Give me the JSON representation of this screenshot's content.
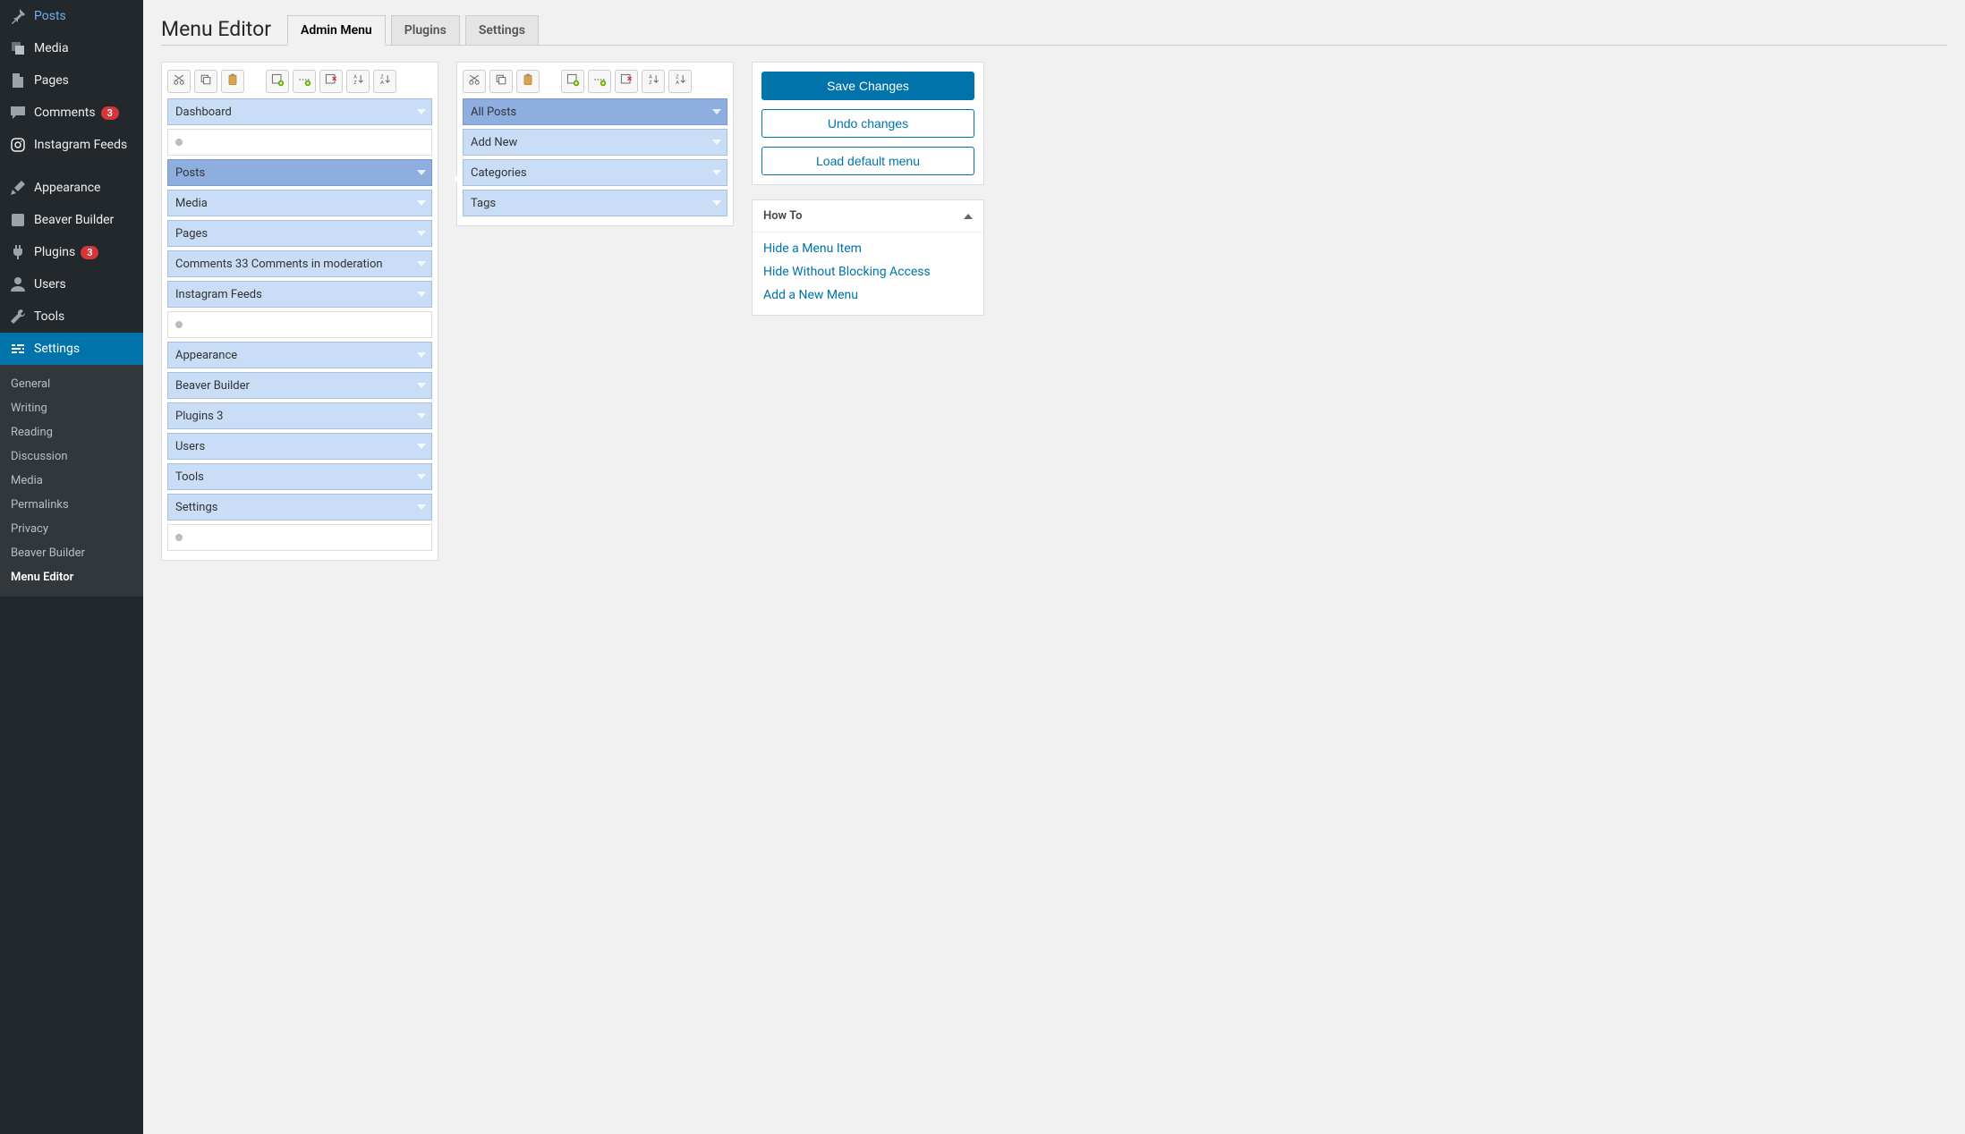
{
  "sidebar": {
    "items": [
      {
        "label": "Posts",
        "icon": "pin"
      },
      {
        "label": "Media",
        "icon": "media"
      },
      {
        "label": "Pages",
        "icon": "pages"
      },
      {
        "label": "Comments",
        "icon": "comments",
        "badge": "3"
      },
      {
        "label": "Instagram Feeds",
        "icon": "instagram"
      }
    ],
    "items2": [
      {
        "label": "Appearance",
        "icon": "brush"
      },
      {
        "label": "Beaver Builder",
        "icon": "generic"
      },
      {
        "label": "Plugins",
        "icon": "plug",
        "badge": "3"
      },
      {
        "label": "Users",
        "icon": "user"
      },
      {
        "label": "Tools",
        "icon": "wrench"
      },
      {
        "label": "Settings",
        "icon": "sliders",
        "active": true
      }
    ],
    "submenu": [
      {
        "label": "General"
      },
      {
        "label": "Writing"
      },
      {
        "label": "Reading"
      },
      {
        "label": "Discussion"
      },
      {
        "label": "Media"
      },
      {
        "label": "Permalinks"
      },
      {
        "label": "Privacy"
      },
      {
        "label": "Beaver Builder"
      },
      {
        "label": "Menu Editor",
        "current": true
      }
    ]
  },
  "header": {
    "title": "Menu Editor",
    "tabs": [
      {
        "label": "Admin Menu",
        "active": true
      },
      {
        "label": "Plugins"
      },
      {
        "label": "Settings"
      }
    ]
  },
  "toolbar": [
    {
      "name": "cut-icon"
    },
    {
      "name": "copy-icon"
    },
    {
      "name": "paste-icon"
    },
    {
      "gap": true
    },
    {
      "name": "new-menu-icon"
    },
    {
      "name": "new-separator-icon"
    },
    {
      "name": "delete-icon"
    },
    {
      "name": "sort-az-icon"
    },
    {
      "name": "sort-za-icon"
    }
  ],
  "left_column": [
    {
      "label": "Dashboard"
    },
    {
      "label": "",
      "sep": true
    },
    {
      "label": "Posts",
      "selected": true
    },
    {
      "label": "Media"
    },
    {
      "label": "Pages"
    },
    {
      "label": "Comments 33 Comments in moderation"
    },
    {
      "label": "Instagram Feeds"
    },
    {
      "label": "",
      "sep": true
    },
    {
      "label": "Appearance"
    },
    {
      "label": "Beaver Builder"
    },
    {
      "label": "Plugins 3"
    },
    {
      "label": "Users"
    },
    {
      "label": "Tools"
    },
    {
      "label": "Settings"
    },
    {
      "label": "",
      "sep": true
    }
  ],
  "right_column": [
    {
      "label": "All Posts",
      "selected": true
    },
    {
      "label": "Add New"
    },
    {
      "label": "Categories"
    },
    {
      "label": "Tags"
    }
  ],
  "actions": {
    "save": "Save Changes",
    "undo": "Undo changes",
    "load_default": "Load default menu"
  },
  "howto": {
    "title": "How To",
    "links": [
      "Hide a Menu Item",
      "Hide Without Blocking Access",
      "Add a New Menu"
    ]
  }
}
